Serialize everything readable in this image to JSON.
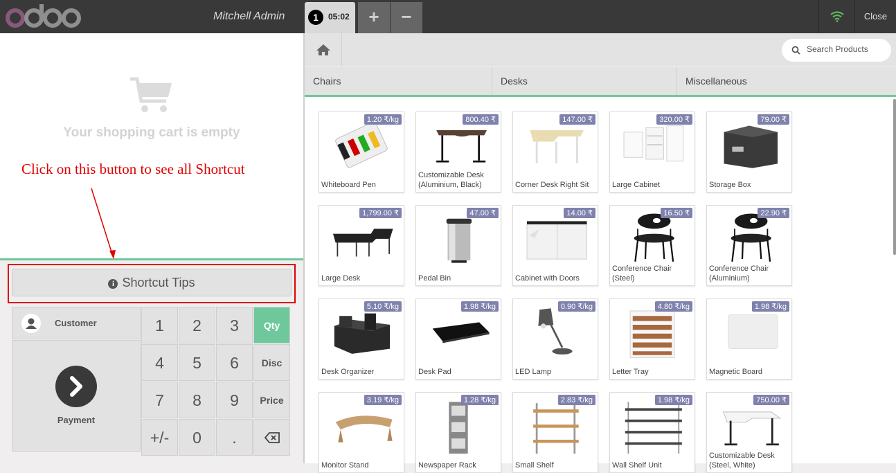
{
  "header": {
    "logo_text": "odoo",
    "cashier": "Mitchell Admin",
    "order_number": "1",
    "order_time": "05:02",
    "add_order_label": "+",
    "remove_order_label": "−",
    "close_label": "Close",
    "wifi_color": "#5cb85c"
  },
  "cart": {
    "empty_text": "Your shopping cart is empty"
  },
  "annotation": {
    "text": "Click on this button to see all Shortcut"
  },
  "shortcut": {
    "label": "Shortcut Tips"
  },
  "actions": {
    "customer_label": "Customer",
    "payment_label": "Payment"
  },
  "numpad": {
    "keys": [
      "1",
      "2",
      "3",
      "4",
      "5",
      "6",
      "7",
      "8",
      "9",
      "+/-",
      "0",
      "."
    ],
    "modes": [
      "Qty",
      "Disc",
      "Price"
    ],
    "active_mode": "Qty",
    "accent": "#6ec89b"
  },
  "search": {
    "placeholder": "Search Products"
  },
  "categories": [
    "Chairs",
    "Desks",
    "Miscellaneous"
  ],
  "products": [
    {
      "name": "Whiteboard Pen",
      "price": "1.20 ₹/kg",
      "icon": "pens"
    },
    {
      "name": "Customizable Desk (Aluminium, Black)",
      "price": "800.40 ₹",
      "icon": "desk-dark"
    },
    {
      "name": "Corner Desk Right Sit",
      "price": "147.00 ₹",
      "icon": "desk-light"
    },
    {
      "name": "Large Cabinet",
      "price": "320.00 ₹",
      "icon": "cabinet-white"
    },
    {
      "name": "Storage Box",
      "price": "79.00 ₹",
      "icon": "box"
    },
    {
      "name": "Large Desk",
      "price": "1,799.00 ₹",
      "icon": "large-desk"
    },
    {
      "name": "Pedal Bin",
      "price": "47.00 ₹",
      "icon": "bin"
    },
    {
      "name": "Cabinet with Doors",
      "price": "14.00 ₹",
      "icon": "cabinet-doors"
    },
    {
      "name": "Conference Chair (Steel)",
      "price": "16.50 ₹",
      "icon": "chair"
    },
    {
      "name": "Conference Chair (Aluminium)",
      "price": "22.90 ₹",
      "icon": "chair"
    },
    {
      "name": "Desk Organizer",
      "price": "5.10 ₹/kg",
      "icon": "organizer"
    },
    {
      "name": "Desk Pad",
      "price": "1.98 ₹/kg",
      "icon": "pad"
    },
    {
      "name": "LED Lamp",
      "price": "0.90 ₹/kg",
      "icon": "lamp"
    },
    {
      "name": "Letter Tray",
      "price": "4.80 ₹/kg",
      "icon": "tray"
    },
    {
      "name": "Magnetic Board",
      "price": "1.98 ₹/kg",
      "icon": "board"
    },
    {
      "name": "Monitor Stand",
      "price": "3.19 ₹/kg",
      "icon": "stand"
    },
    {
      "name": "Newspaper Rack",
      "price": "1.28 ₹/kg",
      "icon": "rack"
    },
    {
      "name": "Small Shelf",
      "price": "2.83 ₹/kg",
      "icon": "shelf-wood"
    },
    {
      "name": "Wall Shelf Unit",
      "price": "1.98 ₹/kg",
      "icon": "shelf-wire"
    },
    {
      "name": "Customizable Desk (Steel, White)",
      "price": "750.00 ₹",
      "icon": "desk-white"
    }
  ]
}
